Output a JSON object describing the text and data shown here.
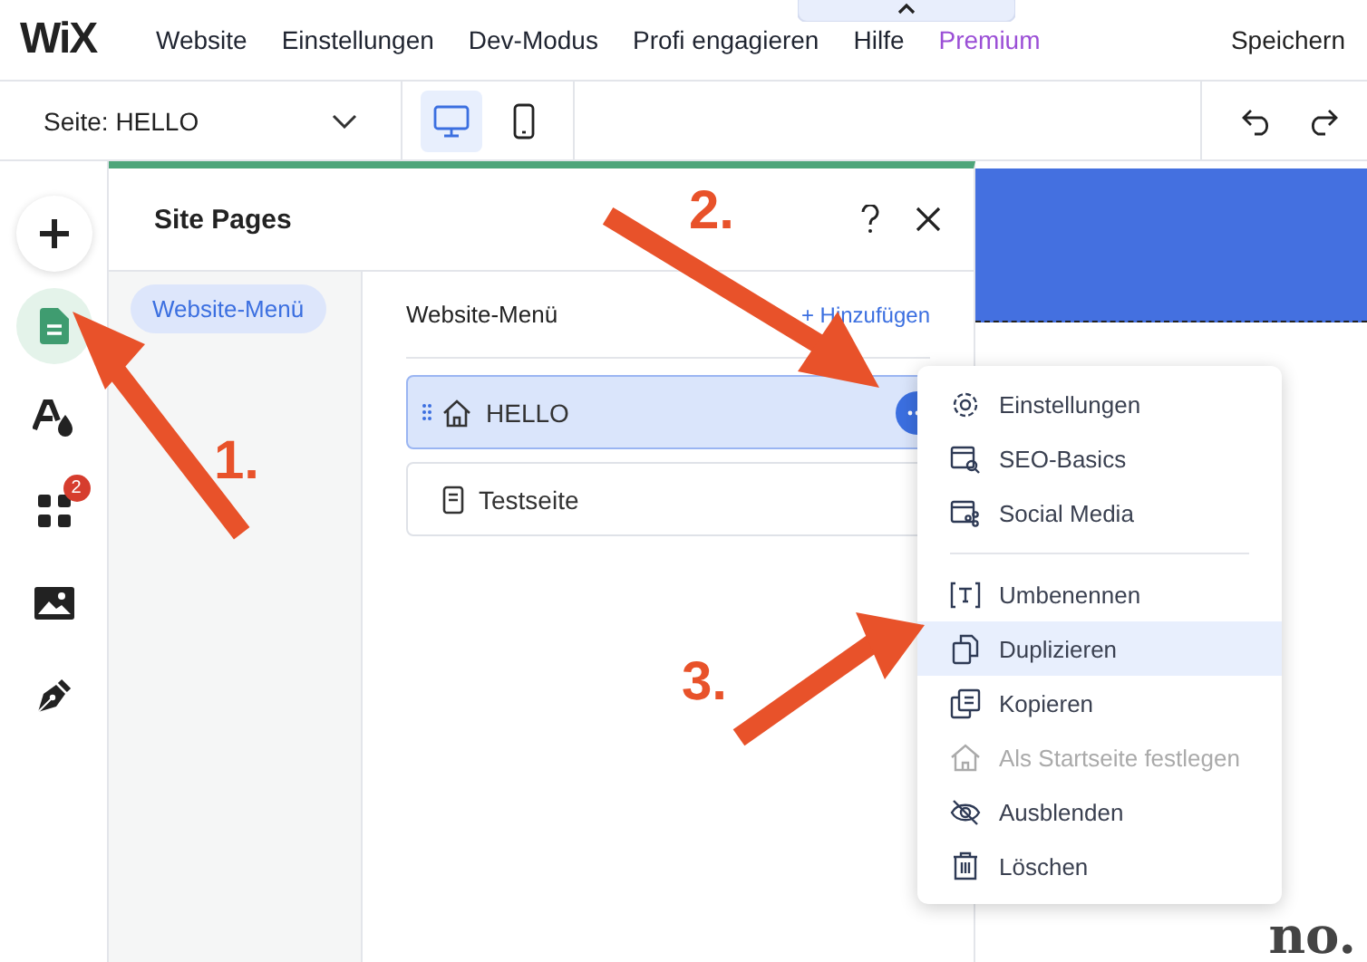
{
  "top_bar": {
    "logo": "WiX",
    "nav": [
      {
        "label": "Website",
        "kind": "normal"
      },
      {
        "label": "Einstellungen",
        "kind": "normal"
      },
      {
        "label": "Dev-Modus",
        "kind": "normal"
      },
      {
        "label": "Profi engagieren",
        "kind": "normal"
      },
      {
        "label": "Hilfe",
        "kind": "normal"
      },
      {
        "label": "Premium",
        "kind": "premium"
      }
    ],
    "save": "Speichern"
  },
  "toolbar": {
    "page_select": "Seite: HELLO",
    "devices": [
      {
        "kind": "desktop",
        "selected": true
      },
      {
        "kind": "mobile",
        "selected": false
      }
    ]
  },
  "sidebar": {
    "tools": [
      {
        "kind": "add",
        "selected": false
      },
      {
        "kind": "pages",
        "selected": true
      },
      {
        "kind": "theme",
        "selected": false
      },
      {
        "kind": "apps",
        "selected": false,
        "badge": "2"
      },
      {
        "kind": "media",
        "selected": false
      },
      {
        "kind": "pen",
        "selected": false
      }
    ]
  },
  "panel": {
    "title": "Site Pages",
    "menus": [
      {
        "label": "Website-Menü",
        "selected": true
      }
    ],
    "section_title": "Website-Menü",
    "add_link": "+ Hinzufügen",
    "pages": [
      {
        "name": "HELLO",
        "kind": "home",
        "selected": true
      },
      {
        "name": "Testseite",
        "kind": "page",
        "selected": false
      }
    ]
  },
  "context_menu": {
    "groups": [
      [
        {
          "label": "Einstellungen",
          "selected": false,
          "disabled": false
        },
        {
          "label": "SEO-Basics",
          "selected": false,
          "disabled": false
        },
        {
          "label": "Social Media",
          "selected": false,
          "disabled": false
        }
      ],
      [
        {
          "label": "Umbenennen",
          "selected": false,
          "disabled": false
        },
        {
          "label": "Duplizieren",
          "selected": true,
          "disabled": false
        },
        {
          "label": "Kopieren",
          "selected": false,
          "disabled": false
        },
        {
          "label": "Als Startseite festlegen",
          "selected": false,
          "disabled": true
        },
        {
          "label": "Ausblenden",
          "selected": false,
          "disabled": false
        },
        {
          "label": "Löschen",
          "selected": false,
          "disabled": false
        }
      ]
    ]
  },
  "canvas": {
    "heading": "no."
  },
  "annotations": [
    {
      "label": "1."
    },
    {
      "label": "2."
    },
    {
      "label": "3."
    }
  ]
}
